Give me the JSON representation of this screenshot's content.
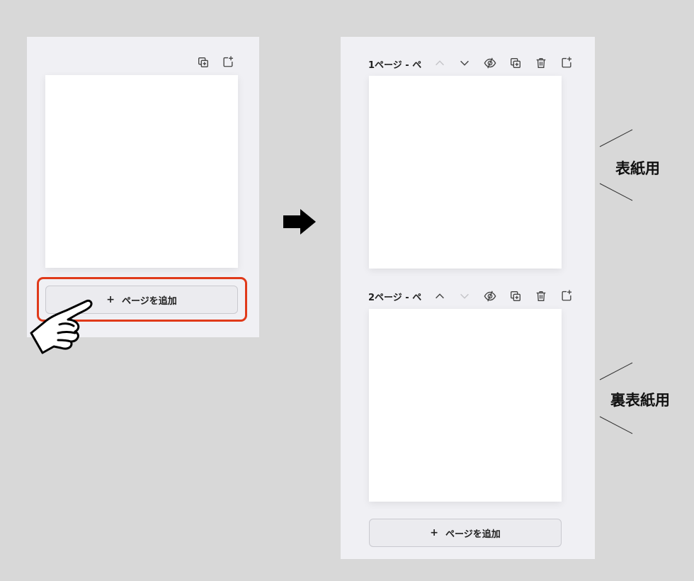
{
  "left_panel": {
    "add_page_button": {
      "plus": "+",
      "label": "ページを追加"
    }
  },
  "right_panel": {
    "pages": [
      {
        "label": "1ページ - ペ",
        "annotation": "表紙用",
        "up_enabled": false,
        "down_enabled": true
      },
      {
        "label": "2ページ - ペ",
        "annotation": "裏表紙用",
        "up_enabled": true,
        "down_enabled": false
      }
    ],
    "add_page_button": {
      "plus": "+",
      "label": "ページを追加"
    }
  },
  "colors": {
    "background": "#d8d8d8",
    "panel": "#f0f0f4",
    "highlight": "#e03a1a"
  },
  "icons": [
    "duplicate-icon",
    "add-page-icon",
    "chevron-up-icon",
    "chevron-down-icon",
    "hide-icon",
    "trash-icon",
    "pointing-hand-icon",
    "right-arrow-icon"
  ]
}
